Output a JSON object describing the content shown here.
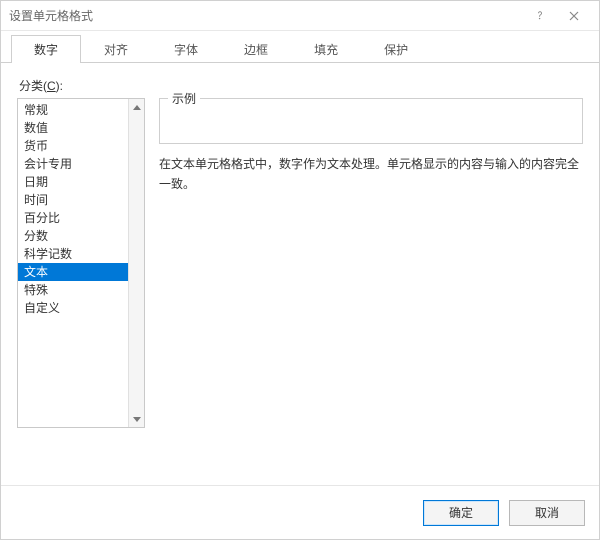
{
  "window": {
    "title": "设置单元格格式"
  },
  "tabs": [
    {
      "label": "数字",
      "active": true
    },
    {
      "label": "对齐",
      "active": false
    },
    {
      "label": "字体",
      "active": false
    },
    {
      "label": "边框",
      "active": false
    },
    {
      "label": "填充",
      "active": false
    },
    {
      "label": "保护",
      "active": false
    }
  ],
  "category": {
    "label_prefix": "分类(",
    "label_key": "C",
    "label_suffix": "):",
    "items": [
      {
        "label": "常规",
        "selected": false
      },
      {
        "label": "数值",
        "selected": false
      },
      {
        "label": "货币",
        "selected": false
      },
      {
        "label": "会计专用",
        "selected": false
      },
      {
        "label": "日期",
        "selected": false
      },
      {
        "label": "时间",
        "selected": false
      },
      {
        "label": "百分比",
        "selected": false
      },
      {
        "label": "分数",
        "selected": false
      },
      {
        "label": "科学记数",
        "selected": false
      },
      {
        "label": "文本",
        "selected": true
      },
      {
        "label": "特殊",
        "selected": false
      },
      {
        "label": "自定义",
        "selected": false
      }
    ]
  },
  "sample": {
    "legend": "示例",
    "value": ""
  },
  "description": "在文本单元格格式中，数字作为文本处理。单元格显示的内容与输入的内容完全一致。",
  "buttons": {
    "ok": "确定",
    "cancel": "取消"
  }
}
